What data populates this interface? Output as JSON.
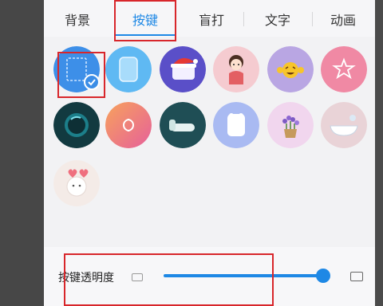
{
  "tabs": [
    {
      "label": "背景",
      "active": false
    },
    {
      "label": "按键",
      "active": true
    },
    {
      "label": "盲打",
      "active": false
    },
    {
      "label": "文字",
      "active": false
    },
    {
      "label": "动画",
      "active": false
    }
  ],
  "skins": [
    {
      "name": "transparent-dashed",
      "selected": true
    },
    {
      "name": "blue-rounded"
    },
    {
      "name": "santa-hat"
    },
    {
      "name": "girl-sticker"
    },
    {
      "name": "laughing-emoji"
    },
    {
      "name": "pink-star"
    },
    {
      "name": "teal-orb"
    },
    {
      "name": "chanel-logo"
    },
    {
      "name": "bed-bath"
    },
    {
      "name": "white-frame"
    },
    {
      "name": "lavender-pot"
    },
    {
      "name": "bathtub"
    },
    {
      "name": "bunny-hearts"
    }
  ],
  "transparency": {
    "label": "按键透明度",
    "value_percent": 100
  },
  "colors": {
    "accent": "#1e88e5",
    "highlight": "#d8262b"
  }
}
